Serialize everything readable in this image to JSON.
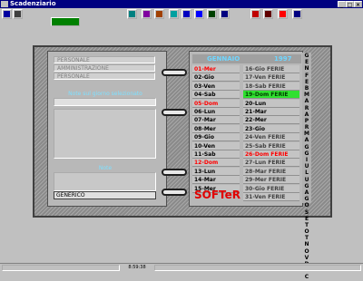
{
  "window": {
    "title": "Scadenziario"
  },
  "toolbar": {
    "main_button": "",
    "buttons": [
      {
        "name": "book-icon",
        "color": "#0000a0"
      },
      {
        "name": "save-icon",
        "color": "#404040"
      },
      {
        "name": "chart-icon",
        "color": "#008080"
      },
      {
        "name": "mail-icon",
        "color": "#8000a0"
      },
      {
        "name": "card-icon",
        "color": "#a04000"
      },
      {
        "name": "calendar-icon",
        "color": "#00a0a0"
      },
      {
        "name": "print-icon",
        "color": "#0000c0"
      },
      {
        "name": "list-icon",
        "color": "#0000ff"
      },
      {
        "name": "phone-icon",
        "color": "#004000"
      },
      {
        "name": "user-icon",
        "color": "#000080"
      },
      {
        "name": "cancel-icon",
        "color": "#c00000"
      },
      {
        "name": "card2-icon",
        "color": "#600000"
      },
      {
        "name": "flag-icon",
        "color": "#ff0000"
      },
      {
        "name": "help-icon",
        "color": "#000080"
      }
    ]
  },
  "left_page": {
    "options": [
      "PERSONALE",
      "AMMINISTRAZIONE",
      "PERSONALE"
    ],
    "section_label": "Note sul giorno selezionato",
    "notes_label": "Note",
    "footer": "GENERICO"
  },
  "calendar": {
    "month": "GENNAIO",
    "year": "1997",
    "col1": [
      {
        "day": "01-Mer",
        "style": "red"
      },
      {
        "day": "02-Gio",
        "style": ""
      },
      {
        "day": "03-Ven",
        "style": ""
      },
      {
        "day": "04-Sab",
        "style": ""
      },
      {
        "day": "05-Dom",
        "style": "red"
      },
      {
        "day": "06-Lun",
        "style": ""
      },
      {
        "day": "07-Mar",
        "style": ""
      },
      {
        "day": "08-Mer",
        "style": ""
      },
      {
        "day": "09-Gio",
        "style": ""
      },
      {
        "day": "10-Ven",
        "style": ""
      },
      {
        "day": "11-Sab",
        "style": ""
      },
      {
        "day": "12-Dom",
        "style": "red"
      },
      {
        "day": "13-Lun",
        "style": ""
      },
      {
        "day": "14-Mar",
        "style": ""
      },
      {
        "day": "15-Mer",
        "style": ""
      }
    ],
    "col2": [
      {
        "day": "16-Gio FERIE",
        "style": "ferie"
      },
      {
        "day": "17-Ven FERIE",
        "style": "ferie"
      },
      {
        "day": "18-Sab FERIE",
        "style": "ferie"
      },
      {
        "day": "19-Dom FERIE",
        "style": "selected"
      },
      {
        "day": "20-Lun",
        "style": ""
      },
      {
        "day": "21-Mar",
        "style": ""
      },
      {
        "day": "22-Mer",
        "style": ""
      },
      {
        "day": "23-Gio",
        "style": ""
      },
      {
        "day": "24-Ven FERIE",
        "style": "ferie"
      },
      {
        "day": "25-Sab FERIE",
        "style": "ferie"
      },
      {
        "day": "26-Dom FERIE",
        "style": "red"
      },
      {
        "day": "27-Lun FERIE",
        "style": "ferie"
      },
      {
        "day": "28-Mar FERIE",
        "style": "ferie"
      },
      {
        "day": "29-Mer FERIE",
        "style": "ferie"
      },
      {
        "day": "30-Gio FERIE",
        "style": "ferie"
      },
      {
        "day": "31-Ven FERIE",
        "style": "ferie"
      }
    ],
    "letters": [
      "G",
      "E",
      "N",
      "F",
      "E",
      "B",
      "M",
      "A",
      "R",
      "A",
      "P",
      "R",
      "M",
      "A",
      "G",
      "G",
      "I",
      "U",
      "L",
      "U",
      "G",
      "A",
      "G",
      "O",
      "S",
      "E",
      "T",
      "O",
      "T",
      "N",
      "O",
      "V",
      "D",
      "I",
      "C"
    ]
  },
  "brand": "SOFTeR",
  "status": {
    "time": "8:59:38"
  }
}
